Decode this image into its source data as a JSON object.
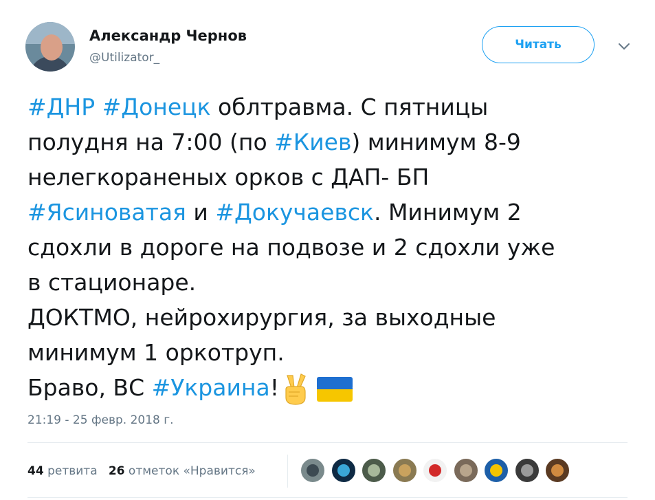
{
  "author": {
    "name": "Александр Чернов",
    "handle": "@Utilizator_"
  },
  "follow_button": "Читать",
  "tweet": {
    "lines": [
      [
        {
          "t": "#ДНР",
          "tag": true
        },
        {
          "t": " "
        },
        {
          "t": "#Донецк",
          "tag": true
        },
        {
          "t": " облтравма. С пятницы"
        }
      ],
      [
        {
          "t": "полудня на 7:00 (по "
        },
        {
          "t": "#Киев",
          "tag": true
        },
        {
          "t": ") минимум 8-9"
        }
      ],
      [
        {
          "t": "нелегкораненых орков с ДАП- БП"
        }
      ],
      [
        {
          "t": "#Ясиноватая",
          "tag": true
        },
        {
          "t": " и "
        },
        {
          "t": "#Докучаевск",
          "tag": true
        },
        {
          "t": ". Минимум 2"
        }
      ],
      [
        {
          "t": "сдохли в дороге на подвозе и 2 сдохли уже"
        }
      ],
      [
        {
          "t": "в стационаре."
        }
      ],
      [
        {
          "t": "ДОКТМО, нейрохирургия, за выходные"
        }
      ],
      [
        {
          "t": "минимум 1 оркотруп."
        }
      ],
      [
        {
          "t": "Браво, ВС "
        },
        {
          "t": "#Украина",
          "tag": true
        },
        {
          "t": "!"
        },
        {
          "emoji": "victory-hand"
        },
        {
          "emoji": "ukraine-flag"
        }
      ]
    ]
  },
  "timestamp": "21:19 - 25 февр. 2018 г.",
  "stats": {
    "retweets_count": "44",
    "retweets_label": "ретвита",
    "likes_count": "26",
    "likes_label": "отметок «Нравится»"
  },
  "liker_avatars": [
    {
      "name": "liker-avatar-1",
      "bg": "#7a8a8c",
      "fg": "#3c4a52"
    },
    {
      "name": "liker-avatar-2",
      "bg": "#0e2a44",
      "fg": "#3aa7d8"
    },
    {
      "name": "liker-avatar-3",
      "bg": "#4c5b4a",
      "fg": "#a7b89a"
    },
    {
      "name": "liker-avatar-4",
      "bg": "#8a7a52",
      "fg": "#c9a25e"
    },
    {
      "name": "liker-avatar-5",
      "bg": "#f2f2f2",
      "fg": "#d22a2a"
    },
    {
      "name": "liker-avatar-6",
      "bg": "#7a6a5a",
      "fg": "#b8a58c"
    },
    {
      "name": "liker-avatar-7",
      "bg": "#1d5fa8",
      "fg": "#f4c400"
    },
    {
      "name": "liker-avatar-8",
      "bg": "#3a3a3a",
      "fg": "#9a9a9a"
    },
    {
      "name": "liker-avatar-9",
      "bg": "#5a3a22",
      "fg": "#d08a40"
    }
  ],
  "colors": {
    "hashtag": "#1b95e0",
    "follow_accent": "#1da1f2",
    "muted": "#657786"
  }
}
